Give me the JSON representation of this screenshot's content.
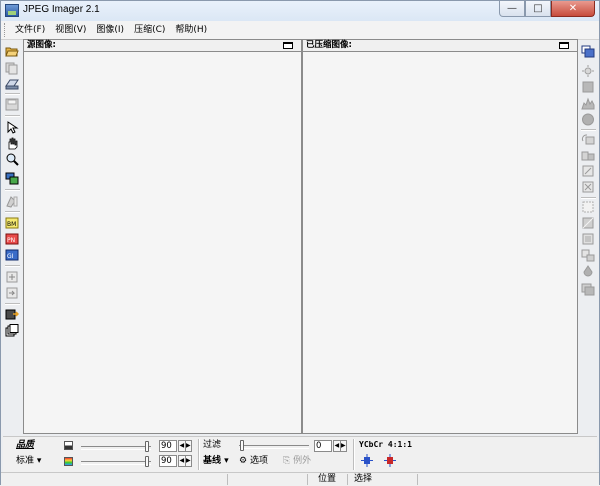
{
  "window": {
    "title": "JPEG Imager 2.1"
  },
  "menu": {
    "items": [
      "文件(F)",
      "视图(V)",
      "图像(I)",
      "压缩(C)",
      "帮助(H)"
    ]
  },
  "left_toolbar": {
    "icons": [
      "open-folder-icon",
      "copy-icon",
      "scan-icon",
      "save-icon",
      "select-arrow-icon",
      "hand-icon",
      "zoom-icon",
      "compare-icon",
      "paint-icon",
      "bmp-convert-icon",
      "png-convert-icon",
      "gif-convert-icon",
      "zoom-in-icon",
      "zoom-out-icon",
      "export-icon",
      "batch-icon"
    ]
  },
  "right_toolbar": {
    "icons": [
      "windows-icon",
      "brightness-icon",
      "square-icon",
      "histogram-icon",
      "circle-icon",
      "rotate-icon",
      "flip-icon",
      "resize-icon",
      "crop-icon",
      "sharpen-icon",
      "blur-icon",
      "filter-icon",
      "emboss-icon",
      "drop-icon",
      "layers-icon"
    ]
  },
  "panes": {
    "source": {
      "title": "源图像:"
    },
    "compressed": {
      "title": "已压缩图像:"
    }
  },
  "bottom": {
    "quality_label": "品质",
    "standard_label": "标准",
    "quality_value_1": "90",
    "quality_value_2": "90",
    "filter_label": "过滤",
    "filter_value": "0",
    "baseline_label": "基线",
    "options_label": "选项",
    "exceptions_label": "例外",
    "ycbcr_label": "YCbCr  4:1:1"
  },
  "status": {
    "position_label": "位置",
    "select_label": "选择"
  },
  "colors": {
    "pane_bg": "#f5f5f5",
    "close_button": "#c74c3c"
  }
}
